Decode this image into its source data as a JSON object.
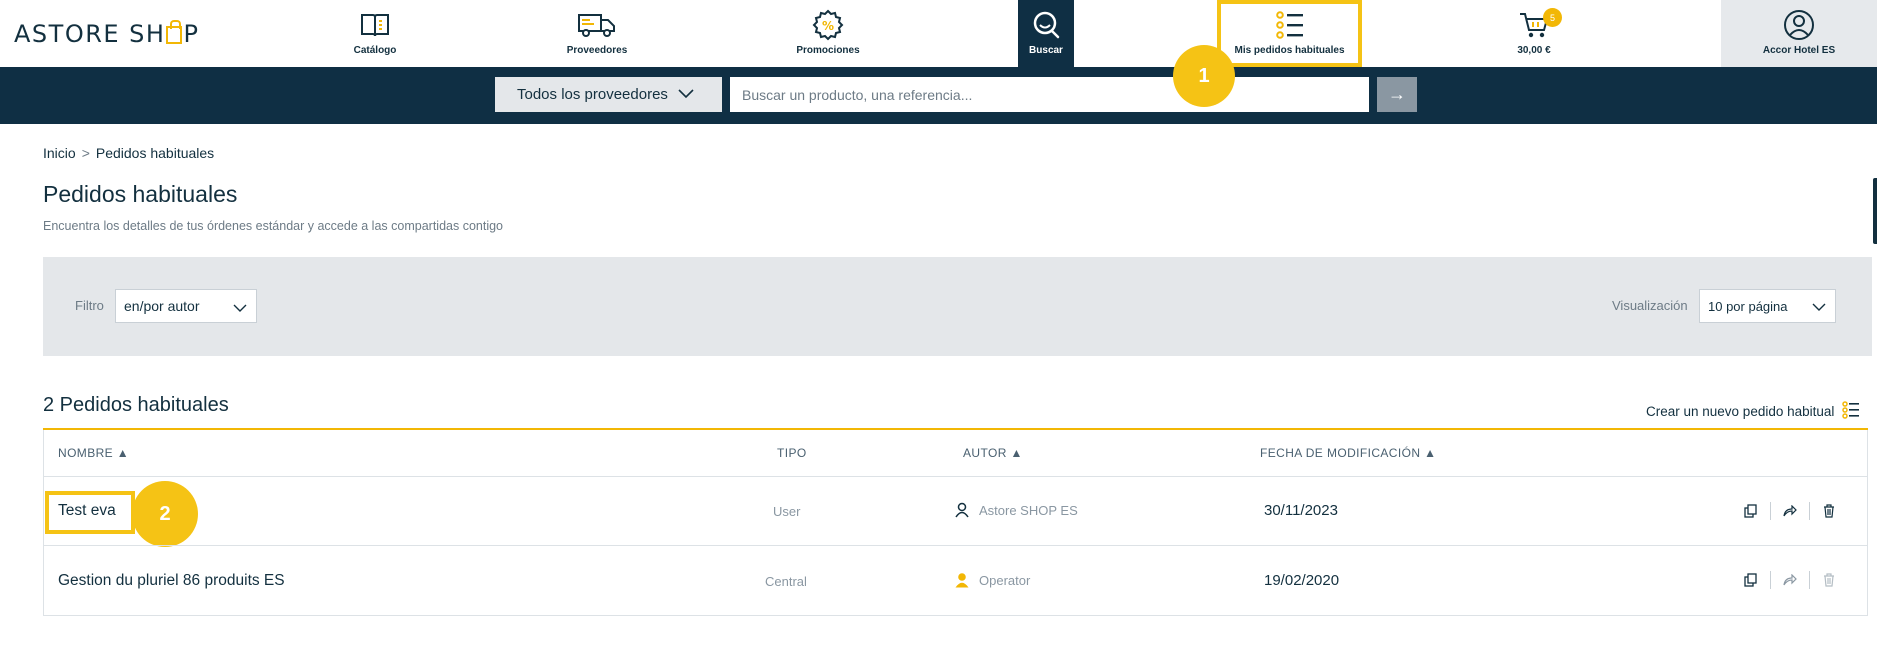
{
  "brand": {
    "name_part1": "ASTORE SH",
    "name_part2": "P",
    "colors": {
      "navy": "#0f2f44",
      "accent": "#f2b705",
      "highlight": "#f5c315"
    }
  },
  "nav": {
    "catalogo": {
      "label": "Catálogo",
      "icon": "book-icon"
    },
    "proveedores": {
      "label": "Proveedores",
      "icon": "truck-icon"
    },
    "promociones": {
      "label": "Promociones",
      "icon": "percent-badge-icon"
    },
    "buscar": {
      "label": "Buscar",
      "icon": "search-icon"
    },
    "pedidos": {
      "label": "Mis pedidos habituales",
      "icon": "list-icon"
    },
    "cart": {
      "label": "30,00 €",
      "badge": "5",
      "icon": "cart-icon"
    },
    "account": {
      "label": "Accor Hotel ES",
      "icon": "user-circle-icon"
    }
  },
  "search": {
    "provider_label": "Todos los proveedores",
    "placeholder": "Buscar un producto, una referencia...",
    "go": "→"
  },
  "steps": {
    "one": "1",
    "two": "2"
  },
  "breadcrumb": {
    "home": "Inicio",
    "sep": ">",
    "current": "Pedidos habituales"
  },
  "page": {
    "title": "Pedidos habituales",
    "subtitle": "Encuentra los detalles de tus órdenes estándar y accede a las compartidas contigo"
  },
  "filters": {
    "filter_label": "Filtro",
    "filter_value": "en/por autor",
    "view_label": "Visualización",
    "view_value": "10 por página"
  },
  "list": {
    "count_title": "2 Pedidos habituales",
    "create_label": "Crear un nuevo pedido habitual",
    "headers": {
      "name": "NOMBRE ▲",
      "type": "TIPO",
      "author": "AUTOR ▲",
      "date": "FECHA DE MODIFICACIÓN ▲"
    },
    "rows": [
      {
        "name": "Test eva",
        "type": "User",
        "author": "Astore SHOP ES",
        "author_icon": "user-outline-icon",
        "date": "30/11/2023"
      },
      {
        "name": "Gestion du pluriel 86 produits ES",
        "type": "Central",
        "author": "Operator",
        "author_icon": "user-filled-icon",
        "date": "19/02/2020"
      }
    ]
  }
}
